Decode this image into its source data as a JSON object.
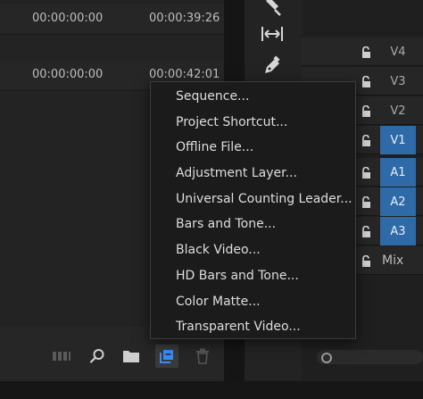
{
  "project_panel": {
    "rows": [
      {
        "in_point": "00:00:00:00",
        "out_point": "00:00:39:26"
      },
      {
        "in_point": "00:00:00:00",
        "out_point": "00:00:42:01"
      }
    ]
  },
  "tools": [
    {
      "icon": "razor-icon"
    },
    {
      "icon": "slip-icon"
    },
    {
      "icon": "pen-icon"
    }
  ],
  "tracks": [
    {
      "label": "V4",
      "active": false
    },
    {
      "label": "V3",
      "active": false
    },
    {
      "label": "V2",
      "active": false
    },
    {
      "label": "V1",
      "active": true
    },
    {
      "label": "A1",
      "active": true
    },
    {
      "label": "A2",
      "active": true
    },
    {
      "label": "A3",
      "active": true
    },
    {
      "label": "Mix",
      "active": false
    }
  ],
  "footer_buttons": [
    {
      "icon": "freeform-view-icon"
    },
    {
      "icon": "search-icon"
    },
    {
      "icon": "new-bin-icon"
    },
    {
      "icon": "new-item-icon"
    },
    {
      "icon": "trash-icon"
    }
  ],
  "context_menu": {
    "items": [
      "Sequence...",
      "Project Shortcut...",
      "Offline File...",
      "Adjustment Layer...",
      "Universal Counting Leader...",
      "Bars and Tone...",
      "Black Video...",
      "HD Bars and Tone...",
      "Color Matte...",
      "Transparent Video..."
    ]
  },
  "colors": {
    "active_track": "#2f6aa8",
    "new_item_icon": "#3d8af0"
  }
}
